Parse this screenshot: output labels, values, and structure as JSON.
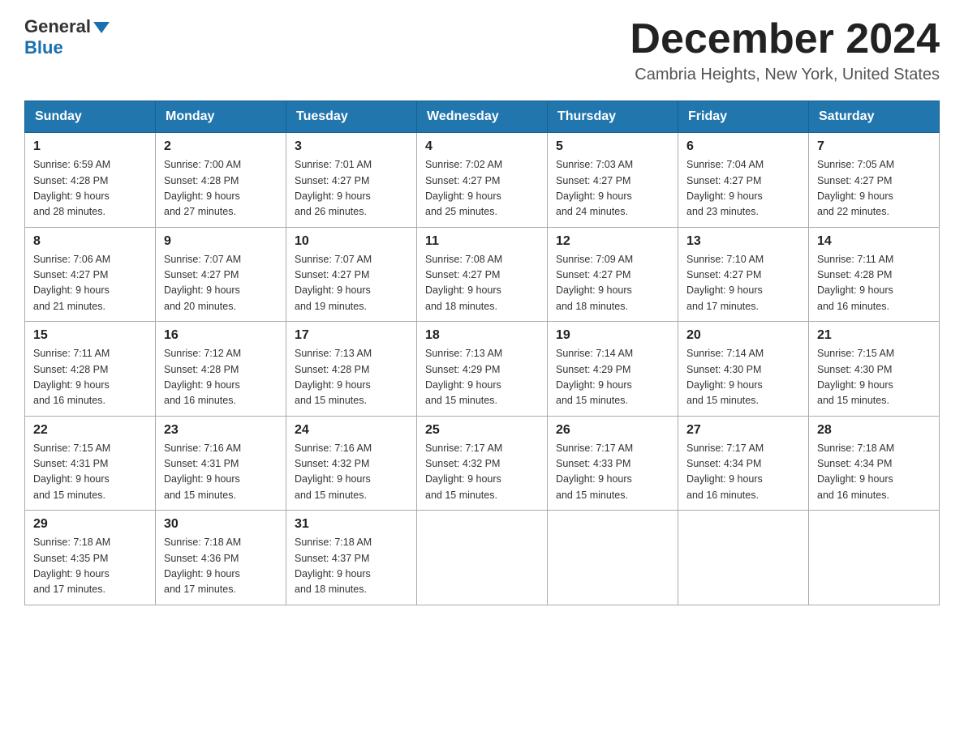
{
  "header": {
    "logo_general": "General",
    "logo_blue": "Blue",
    "month_title": "December 2024",
    "location": "Cambria Heights, New York, United States"
  },
  "weekdays": [
    "Sunday",
    "Monday",
    "Tuesday",
    "Wednesday",
    "Thursday",
    "Friday",
    "Saturday"
  ],
  "weeks": [
    [
      {
        "day": "1",
        "sunrise": "6:59 AM",
        "sunset": "4:28 PM",
        "daylight": "9 hours and 28 minutes."
      },
      {
        "day": "2",
        "sunrise": "7:00 AM",
        "sunset": "4:28 PM",
        "daylight": "9 hours and 27 minutes."
      },
      {
        "day": "3",
        "sunrise": "7:01 AM",
        "sunset": "4:27 PM",
        "daylight": "9 hours and 26 minutes."
      },
      {
        "day": "4",
        "sunrise": "7:02 AM",
        "sunset": "4:27 PM",
        "daylight": "9 hours and 25 minutes."
      },
      {
        "day": "5",
        "sunrise": "7:03 AM",
        "sunset": "4:27 PM",
        "daylight": "9 hours and 24 minutes."
      },
      {
        "day": "6",
        "sunrise": "7:04 AM",
        "sunset": "4:27 PM",
        "daylight": "9 hours and 23 minutes."
      },
      {
        "day": "7",
        "sunrise": "7:05 AM",
        "sunset": "4:27 PM",
        "daylight": "9 hours and 22 minutes."
      }
    ],
    [
      {
        "day": "8",
        "sunrise": "7:06 AM",
        "sunset": "4:27 PM",
        "daylight": "9 hours and 21 minutes."
      },
      {
        "day": "9",
        "sunrise": "7:07 AM",
        "sunset": "4:27 PM",
        "daylight": "9 hours and 20 minutes."
      },
      {
        "day": "10",
        "sunrise": "7:07 AM",
        "sunset": "4:27 PM",
        "daylight": "9 hours and 19 minutes."
      },
      {
        "day": "11",
        "sunrise": "7:08 AM",
        "sunset": "4:27 PM",
        "daylight": "9 hours and 18 minutes."
      },
      {
        "day": "12",
        "sunrise": "7:09 AM",
        "sunset": "4:27 PM",
        "daylight": "9 hours and 18 minutes."
      },
      {
        "day": "13",
        "sunrise": "7:10 AM",
        "sunset": "4:27 PM",
        "daylight": "9 hours and 17 minutes."
      },
      {
        "day": "14",
        "sunrise": "7:11 AM",
        "sunset": "4:28 PM",
        "daylight": "9 hours and 16 minutes."
      }
    ],
    [
      {
        "day": "15",
        "sunrise": "7:11 AM",
        "sunset": "4:28 PM",
        "daylight": "9 hours and 16 minutes."
      },
      {
        "day": "16",
        "sunrise": "7:12 AM",
        "sunset": "4:28 PM",
        "daylight": "9 hours and 16 minutes."
      },
      {
        "day": "17",
        "sunrise": "7:13 AM",
        "sunset": "4:28 PM",
        "daylight": "9 hours and 15 minutes."
      },
      {
        "day": "18",
        "sunrise": "7:13 AM",
        "sunset": "4:29 PM",
        "daylight": "9 hours and 15 minutes."
      },
      {
        "day": "19",
        "sunrise": "7:14 AM",
        "sunset": "4:29 PM",
        "daylight": "9 hours and 15 minutes."
      },
      {
        "day": "20",
        "sunrise": "7:14 AM",
        "sunset": "4:30 PM",
        "daylight": "9 hours and 15 minutes."
      },
      {
        "day": "21",
        "sunrise": "7:15 AM",
        "sunset": "4:30 PM",
        "daylight": "9 hours and 15 minutes."
      }
    ],
    [
      {
        "day": "22",
        "sunrise": "7:15 AM",
        "sunset": "4:31 PM",
        "daylight": "9 hours and 15 minutes."
      },
      {
        "day": "23",
        "sunrise": "7:16 AM",
        "sunset": "4:31 PM",
        "daylight": "9 hours and 15 minutes."
      },
      {
        "day": "24",
        "sunrise": "7:16 AM",
        "sunset": "4:32 PM",
        "daylight": "9 hours and 15 minutes."
      },
      {
        "day": "25",
        "sunrise": "7:17 AM",
        "sunset": "4:32 PM",
        "daylight": "9 hours and 15 minutes."
      },
      {
        "day": "26",
        "sunrise": "7:17 AM",
        "sunset": "4:33 PM",
        "daylight": "9 hours and 15 minutes."
      },
      {
        "day": "27",
        "sunrise": "7:17 AM",
        "sunset": "4:34 PM",
        "daylight": "9 hours and 16 minutes."
      },
      {
        "day": "28",
        "sunrise": "7:18 AM",
        "sunset": "4:34 PM",
        "daylight": "9 hours and 16 minutes."
      }
    ],
    [
      {
        "day": "29",
        "sunrise": "7:18 AM",
        "sunset": "4:35 PM",
        "daylight": "9 hours and 17 minutes."
      },
      {
        "day": "30",
        "sunrise": "7:18 AM",
        "sunset": "4:36 PM",
        "daylight": "9 hours and 17 minutes."
      },
      {
        "day": "31",
        "sunrise": "7:18 AM",
        "sunset": "4:37 PM",
        "daylight": "9 hours and 18 minutes."
      },
      null,
      null,
      null,
      null
    ]
  ],
  "labels": {
    "sunrise_prefix": "Sunrise: ",
    "sunset_prefix": "Sunset: ",
    "daylight_prefix": "Daylight: "
  }
}
